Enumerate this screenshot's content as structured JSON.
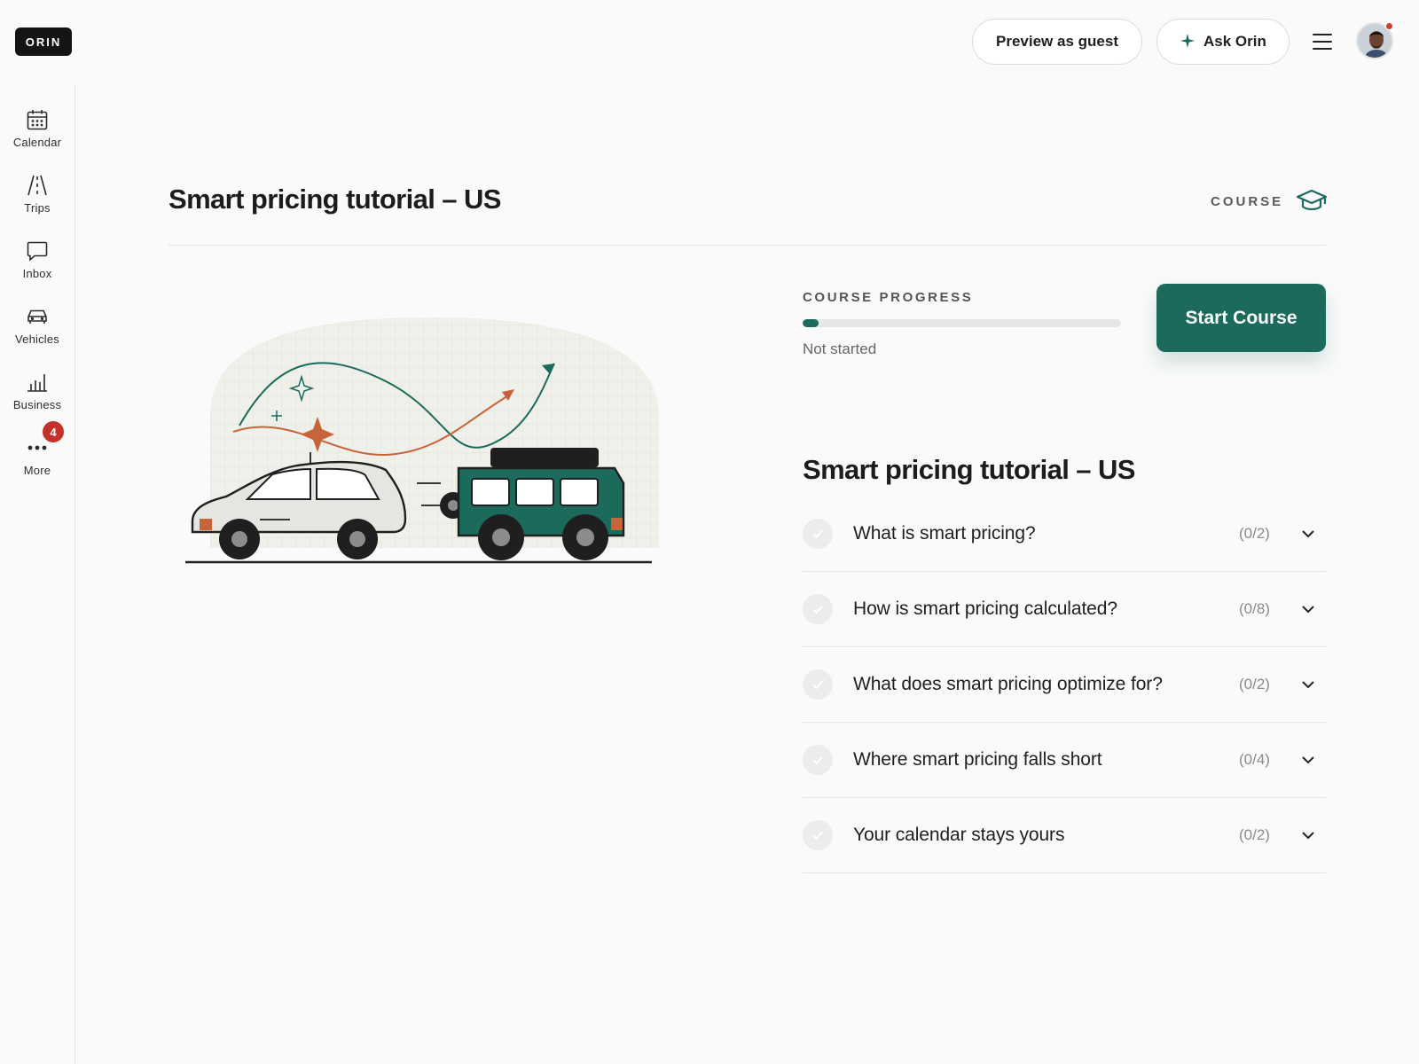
{
  "header": {
    "logo": "ORIN",
    "preview_label": "Preview as guest",
    "ask_label": "Ask Orin"
  },
  "sidebar": {
    "items": [
      {
        "label": "Calendar",
        "icon": "calendar-icon"
      },
      {
        "label": "Trips",
        "icon": "road-icon"
      },
      {
        "label": "Inbox",
        "icon": "chat-bubble-icon"
      },
      {
        "label": "Vehicles",
        "icon": "car-icon"
      },
      {
        "label": "Business",
        "icon": "bar-chart-icon"
      },
      {
        "label": "More",
        "icon": "more-dots-icon"
      }
    ],
    "more_badge": "4"
  },
  "course": {
    "title": "Smart pricing tutorial – US",
    "tag": "COURSE",
    "progress_label": "COURSE PROGRESS",
    "progress_value": 0,
    "status": "Not started",
    "start_label": "Start Course",
    "section_title": "Smart pricing tutorial – US",
    "modules": [
      {
        "title": "What is smart pricing?",
        "count": "(0/2)"
      },
      {
        "title": "How is smart pricing calculated?",
        "count": "(0/8)"
      },
      {
        "title": "What does smart pricing optimize for?",
        "count": "(0/2)"
      },
      {
        "title": "Where smart pricing falls short",
        "count": "(0/4)"
      },
      {
        "title": "Your calendar stays yours",
        "count": "(0/2)"
      }
    ]
  },
  "colors": {
    "accent": "#1b6a5c",
    "illustration_orange": "#c8643a",
    "badge_red": "#c3322a"
  }
}
